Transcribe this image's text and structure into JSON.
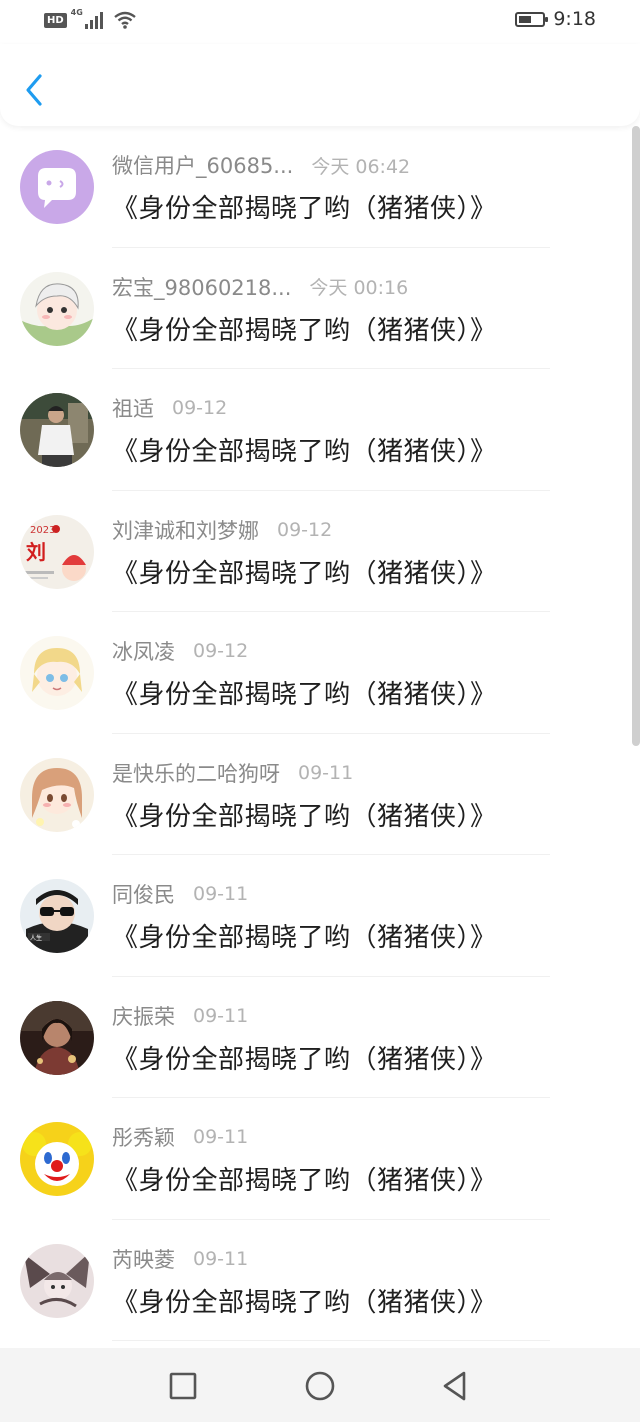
{
  "status_bar": {
    "network": "4G",
    "hd": "HD",
    "time": "9:18",
    "battery_level": 0.55
  },
  "list": [
    {
      "name": "微信用户_60685...",
      "date": "今天 06:42",
      "message": "《身份全部揭晓了哟（猪猪侠）》",
      "avatar": "wechat-default-avatar"
    },
    {
      "name": "宏宝_98060218...",
      "date": "今天 00:16",
      "message": "《身份全部揭晓了哟（猪猪侠）》",
      "avatar": "cartoon-girl-avatar"
    },
    {
      "name": "祖适",
      "date": "09-12",
      "message": "《身份全部揭晓了哟（猪猪侠）》",
      "avatar": "boy-photo-avatar"
    },
    {
      "name": "刘津诚和刘梦娜",
      "date": "09-12",
      "message": "《身份全部揭晓了哟（猪猪侠）》",
      "avatar": "liu-2023-avatar"
    },
    {
      "name": "冰凤凌",
      "date": "09-12",
      "message": "《身份全部揭晓了哟（猪猪侠）》",
      "avatar": "anime-blonde-avatar"
    },
    {
      "name": "是快乐的二哈狗呀",
      "date": "09-11",
      "message": "《身份全部揭晓了哟（猪猪侠）》",
      "avatar": "anime-girl-avatar"
    },
    {
      "name": "同俊民",
      "date": "09-11",
      "message": "《身份全部揭晓了哟（猪猪侠）》",
      "avatar": "sunglasses-avatar"
    },
    {
      "name": "庆振荣",
      "date": "09-11",
      "message": "《身份全部揭晓了哟（猪猪侠）》",
      "avatar": "dark-photo-avatar"
    },
    {
      "name": "彤秀颖",
      "date": "09-11",
      "message": "《身份全部揭晓了哟（猪猪侠）》",
      "avatar": "clown-avatar"
    },
    {
      "name": "芮映菱",
      "date": "09-11",
      "message": "《身份全部揭晓了哟（猪猪侠）》",
      "avatar": "sketch-avatar"
    }
  ],
  "nav_keys": [
    "recent-apps",
    "home",
    "back"
  ],
  "colors": {
    "accent": "#1e9cf0",
    "name": "#8a8a8a",
    "date": "#b3b3b3",
    "message": "#1f1f1f"
  }
}
